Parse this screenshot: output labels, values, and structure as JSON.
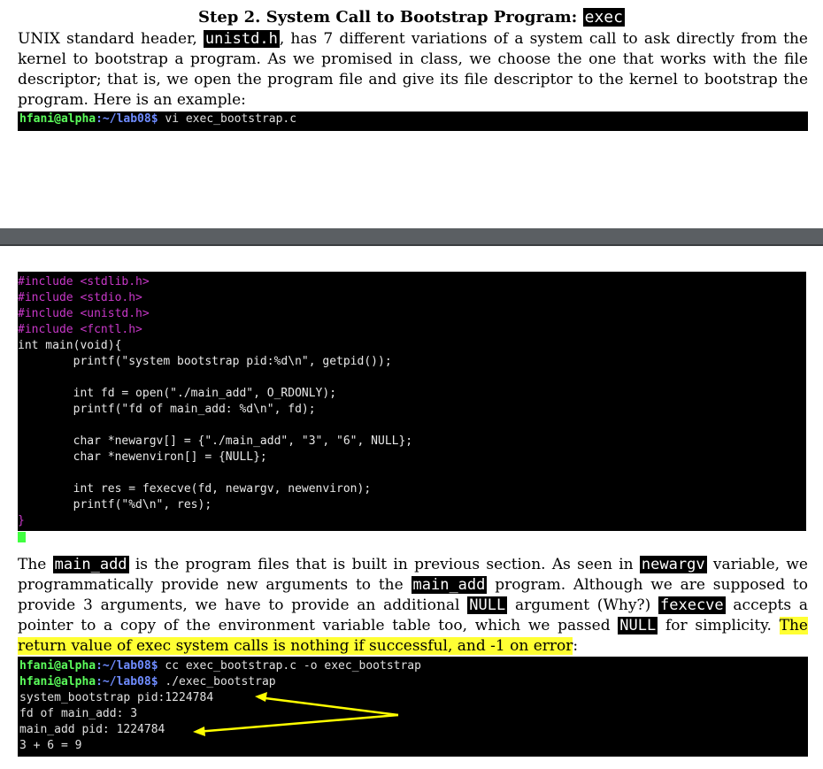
{
  "heading": {
    "text": "Step 2. System Call to Bootstrap Program: ",
    "code": "exec"
  },
  "intro": {
    "part1": "UNIX standard header, ",
    "code": "unistd.h",
    "part2": ", has 7 different variations of a system call to ask directly from the kernel to bootstrap a program. As we promised in class, we choose the one that works with the file descriptor; that is, we open the program file and give its file descriptor to the kernel to bootstrap the program. Here is an example:"
  },
  "terminal1": {
    "user": "hfani@alpha",
    "path": ":~/lab08$",
    "command": " vi exec_bootstrap.c"
  },
  "code_lines": [
    "#include <stdlib.h>",
    "#include <stdio.h>",
    "#include <unistd.h>",
    "#include <fcntl.h>",
    "int main(void){",
    "        printf(\"system bootstrap pid:%d\\n\", getpid());",
    "",
    "        int fd = open(\"./main_add\", O_RDONLY);",
    "        printf(\"fd of main_add: %d\\n\", fd);",
    "",
    "        char *newargv[] = {\"./main_add\", \"3\", \"6\", NULL};",
    "        char *newenviron[] = {NULL};",
    "",
    "        int res = fexecve(fd, newargv, newenviron);",
    "        printf(\"%d\\n\", res);",
    "}"
  ],
  "para2": {
    "t1": "The ",
    "c1": "main_add",
    "t2": " is the program files that is built in previous section. As seen in ",
    "c2": "newargv",
    "t3": " variable, we programmatically provide new arguments to the ",
    "c3": "main_add",
    "t4": " program. Although we are supposed to provide 3 arguments, we have to provide an additional ",
    "c4": "NULL",
    "t5": " argument (Why?) ",
    "c5": "fexecve",
    "t6": " accepts a pointer to a copy of the environment variable table too, which we passed ",
    "c6": "NULL",
    "t7": " for simplicity. ",
    "highlight": "The return value of exec system calls is nothing if successful, and -1 on error",
    "t8": ":"
  },
  "terminal2": {
    "lines": [
      {
        "user": "hfani@alpha",
        "path": ":~/lab08$",
        "command": " cc exec_bootstrap.c -o exec_bootstrap"
      },
      {
        "user": "hfani@alpha",
        "path": ":~/lab08$",
        "command": " ./exec_bootstrap"
      },
      {
        "output": "system_bootstrap pid:1224784"
      },
      {
        "output": "fd of main_add: 3"
      },
      {
        "output": "main_add pid: 1224784"
      },
      {
        "output": "3 + 6 = 9"
      }
    ]
  },
  "colors": {
    "arrow": "#ffff00",
    "prompt": "#5cff5c",
    "highlight": "#ffff33"
  }
}
